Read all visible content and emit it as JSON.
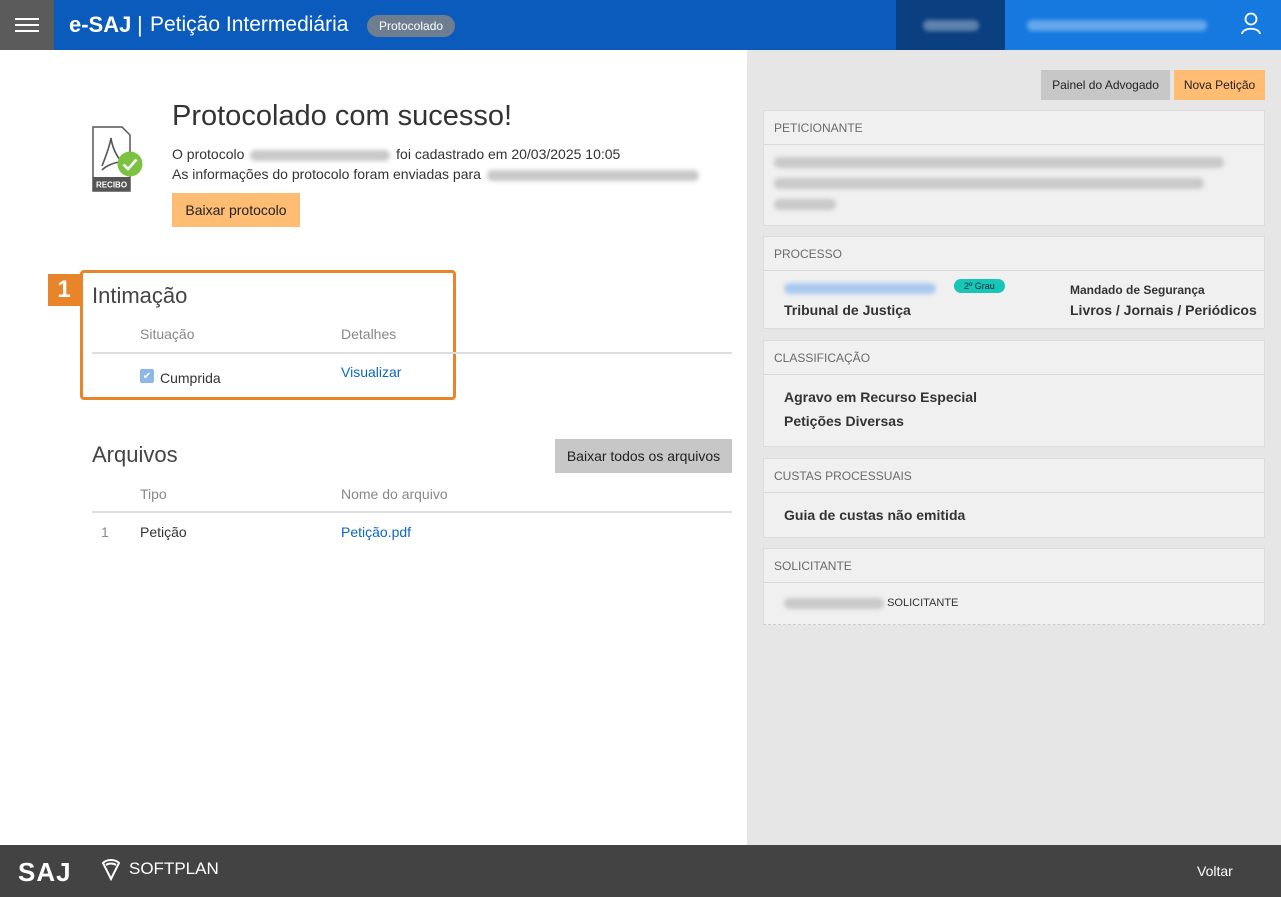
{
  "header": {
    "brand": "e-SAJ",
    "separator": "|",
    "title": "Petição Intermediária",
    "status": "Protocolado",
    "menu_icon": "hamburger-icon",
    "user_icon": "user-icon",
    "colors": {
      "bar": "#0b5bbd",
      "user_block": "#1579e0",
      "dark_block": "#0a3f80"
    }
  },
  "success": {
    "title": "Protocolado com sucesso!",
    "protocol_prefix": "O protocolo",
    "protocol_suffix": "foi cadastrado em 20/03/2025 10:05",
    "email_prefix": "As informações do protocolo foram enviadas para",
    "download_button": "Baixar protocolo",
    "icon_label": "RECIBO"
  },
  "intimacao": {
    "badge": "1",
    "title": "Intimação",
    "columns": [
      "Situação",
      "Detalhes"
    ],
    "rows": [
      {
        "situacao": "Cumprida",
        "detalhes": "Visualizar"
      }
    ]
  },
  "arquivos": {
    "title": "Arquivos",
    "download_all": "Baixar todos os arquivos",
    "columns": [
      "Tipo",
      "Nome do arquivo"
    ],
    "rows": [
      {
        "index": "1",
        "tipo": "Petição",
        "nome": "Petição.pdf"
      }
    ]
  },
  "sidebar": {
    "buttons": {
      "painel": "Painel do Advogado",
      "nova": "Nova Petição"
    },
    "peticionante": {
      "heading": "PETICIONANTE"
    },
    "processo": {
      "heading": "PROCESSO",
      "grau": "2º Grau",
      "tribunal": "Tribunal de Justiça",
      "classe": "Mandado de Segurança",
      "assunto": "Livros / Jornais / Periódicos"
    },
    "classificacao": {
      "heading": "CLASSIFICAÇÃO",
      "items": [
        "Agravo em Recurso Especial",
        "Petições Diversas"
      ]
    },
    "custas": {
      "heading": "CUSTAS PROCESSUAIS",
      "text": "Guia de custas não emitida"
    },
    "solicitante": {
      "heading": "SOLICITANTE",
      "role": "SOLICITANTE"
    }
  },
  "footer": {
    "saj": "SAJ",
    "softplan": "SOFTPLAN",
    "voltar": "Voltar"
  }
}
